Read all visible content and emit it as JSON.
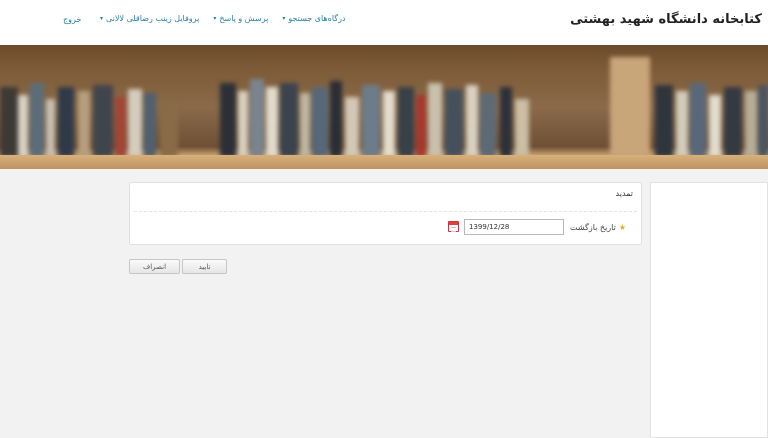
{
  "header": {
    "brand": "کتابخانه دانشگاه شهید بهشتی",
    "nav": [
      {
        "label": "درگاه‌های جستجو"
      },
      {
        "label": "پرسش و پاسخ"
      },
      {
        "label": "پروفایل زینب رضاقلی لالانی"
      }
    ],
    "logout": "خروج",
    "caret": "▾"
  },
  "panel": {
    "title": "تمدید",
    "field_label": "تاریخ بازگشت",
    "date_value": "1399/12/28",
    "required_icon": "star-icon",
    "calendar_icon": "calendar-icon"
  },
  "buttons": {
    "confirm": "تایید",
    "cancel": "انصراف"
  },
  "colors": {
    "link": "#2a7fa8",
    "background": "#f2f2f2"
  }
}
